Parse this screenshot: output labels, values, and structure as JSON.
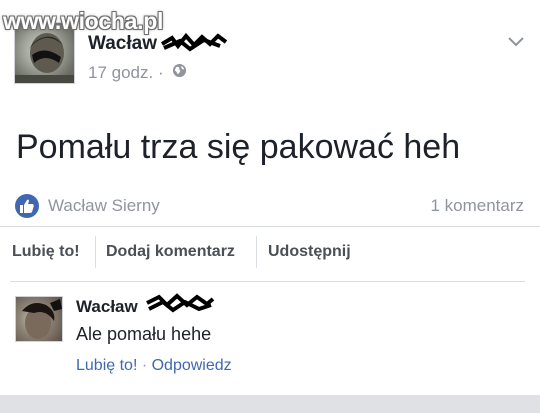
{
  "watermark": "www.wiocha.pl",
  "post": {
    "author": "Wacław",
    "timestamp": "17 godz. ·",
    "privacy_icon": "globe-icon",
    "menu_icon": "chevron-down-icon",
    "text": "Pomału trza się pakować heh"
  },
  "reactions": {
    "icon": "thumbs-up-icon",
    "likers": "Wacław Sierny",
    "comments_count": "1 komentarz"
  },
  "actions": {
    "like": "Lubię to!",
    "comment": "Dodaj komentarz",
    "share": "Udostępnij"
  },
  "comment": {
    "author": "Wacław",
    "text": "Ale pomału hehe",
    "like": "Lubię to!",
    "separator": " · ",
    "reply": "Odpowiedz"
  },
  "colors": {
    "link_blue": "#4267b2",
    "text_dark": "#1d2129",
    "text_gray": "#90949c",
    "background": "#e9ebee"
  }
}
